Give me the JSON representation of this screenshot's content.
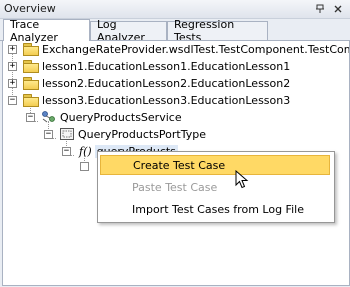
{
  "panel": {
    "title": "Overview",
    "pin_icon": "pin-icon",
    "close_icon": "close-icon"
  },
  "tabs": [
    {
      "label": "Trace Analyzer",
      "active": true
    },
    {
      "label": "Log Analyzer",
      "active": false
    },
    {
      "label": "Regression Tests",
      "active": false
    }
  ],
  "tree": {
    "items": [
      {
        "label": "ExchangeRateProvider.wsdlTest.TestComponent.TestComponent",
        "expander": "+"
      },
      {
        "label": "lesson1.EducationLesson1.EducationLesson1",
        "expander": "+"
      },
      {
        "label": "lesson2.EducationLesson2.EducationLesson2",
        "expander": "+"
      },
      {
        "label": "lesson3.EducationLesson3.EducationLesson3",
        "expander": "−"
      },
      {
        "label": "QueryProductsService",
        "expander": "−"
      },
      {
        "label": "QueryProductsPortType",
        "expander": "−"
      },
      {
        "label": "queryProducts",
        "expander": "−",
        "icon_text": "f()"
      }
    ]
  },
  "context_menu": {
    "items": [
      {
        "label": "Create Test Case",
        "state": "highlighted"
      },
      {
        "label": "Paste Test Case",
        "state": "disabled"
      },
      {
        "label": "Import Test Cases from Log File",
        "state": "enabled"
      }
    ]
  },
  "colors": {
    "highlight": "#ffd965",
    "folder": "#f3cd52",
    "border": "#a9b2c2"
  }
}
